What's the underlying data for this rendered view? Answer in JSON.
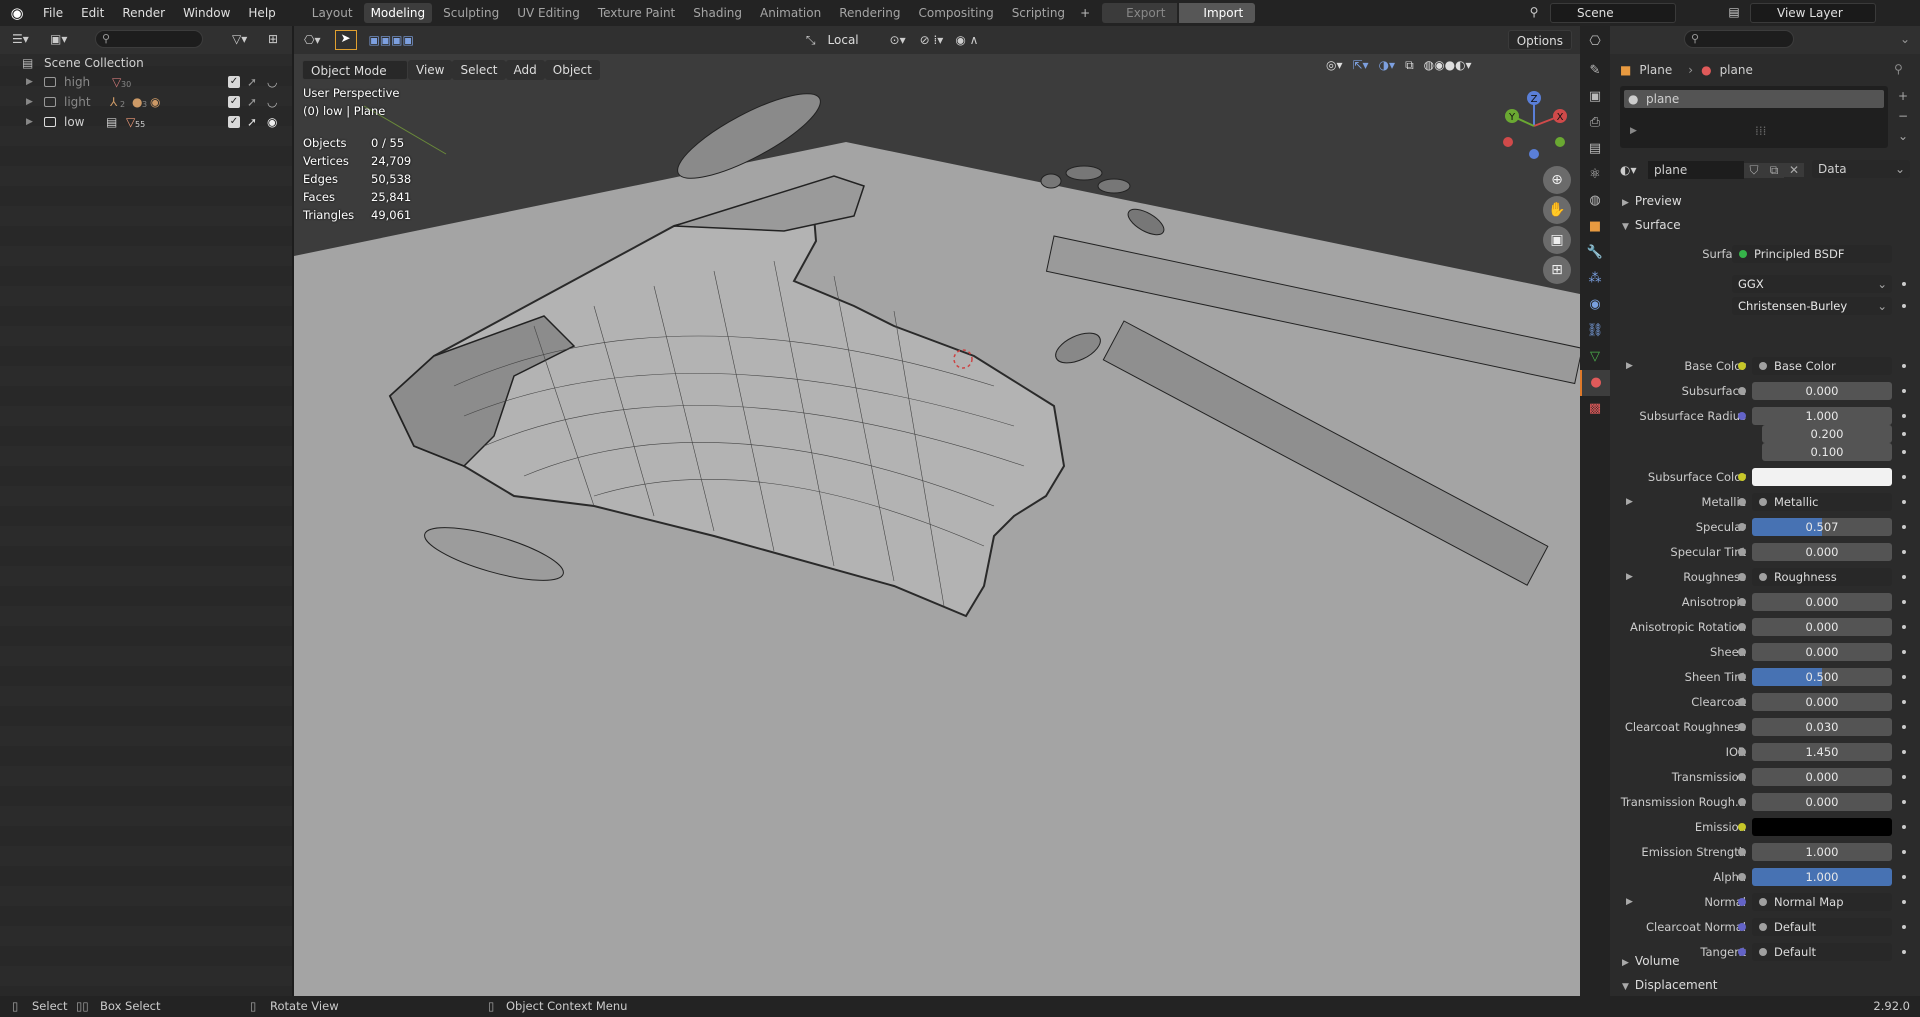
{
  "topbar": {
    "menus": [
      "File",
      "Edit",
      "Render",
      "Window",
      "Help"
    ],
    "workspaces": [
      "Layout",
      "Modeling",
      "Sculpting",
      "UV Editing",
      "Texture Paint",
      "Shading",
      "Animation",
      "Rendering",
      "Compositing",
      "Scripting"
    ],
    "active_workspace": "Modeling",
    "export_label": "Export",
    "import_label": "Import",
    "scene": "Scene",
    "view_layer": "View Layer"
  },
  "outliner": {
    "root": "Scene Collection",
    "collections": [
      {
        "name": "high",
        "count": "30"
      },
      {
        "name": "light",
        "count": "2",
        "count2": "3"
      },
      {
        "name": "low",
        "count": "55"
      }
    ]
  },
  "viewport": {
    "mode": "Object Mode",
    "menus": [
      "View",
      "Select",
      "Add",
      "Object"
    ],
    "orientation": "Local",
    "options": "Options",
    "perspective": "User Perspective",
    "context": "(0) low | Plane",
    "stats": [
      {
        "label": "Objects",
        "value": "0 / 55"
      },
      {
        "label": "Vertices",
        "value": "24,709"
      },
      {
        "label": "Edges",
        "value": "50,538"
      },
      {
        "label": "Faces",
        "value": "25,841"
      },
      {
        "label": "Triangles",
        "value": "49,061"
      }
    ],
    "gizmo": {
      "x": "X",
      "y": "Y",
      "z": "Z"
    }
  },
  "properties": {
    "object": "Plane",
    "data": "plane",
    "material_slot": "plane",
    "material_name": "plane",
    "link_mode": "Data",
    "panels": {
      "preview": "Preview",
      "surface": "Surface",
      "volume": "Volume",
      "displacement": "Displacement"
    },
    "surface_label": "Surface",
    "surface_shader": "Principled BSDF",
    "distribution": "GGX",
    "subsurface_method": "Christensen-Burley",
    "rows": [
      {
        "label": "Base Color",
        "value": "Base Color",
        "kind": "link",
        "dot": "yellow",
        "expand": true
      },
      {
        "label": "Subsurface",
        "value": "0.000",
        "kind": "num"
      },
      {
        "label": "Subsurface Radius",
        "value": "1.000",
        "kind": "num",
        "dot": "blue"
      },
      {
        "label": "",
        "value": "0.200",
        "kind": "num",
        "nodot": true
      },
      {
        "label": "",
        "value": "0.100",
        "kind": "num",
        "nodot": true
      },
      {
        "label": "Subsurface Color",
        "value": "",
        "kind": "color",
        "color": "#f2f2f2",
        "dot": "yellow"
      },
      {
        "label": "Metallic",
        "value": "Metallic",
        "kind": "link",
        "expand": true
      },
      {
        "label": "Specular",
        "value": "0.507",
        "kind": "half"
      },
      {
        "label": "Specular Tint",
        "value": "0.000",
        "kind": "num"
      },
      {
        "label": "Roughness",
        "value": "Roughness",
        "kind": "link",
        "expand": true
      },
      {
        "label": "Anisotropic",
        "value": "0.000",
        "kind": "num"
      },
      {
        "label": "Anisotropic Rotation",
        "value": "0.000",
        "kind": "num"
      },
      {
        "label": "Sheen",
        "value": "0.000",
        "kind": "num"
      },
      {
        "label": "Sheen Tint",
        "value": "0.500",
        "kind": "half"
      },
      {
        "label": "Clearcoat",
        "value": "0.000",
        "kind": "num"
      },
      {
        "label": "Clearcoat Roughness",
        "value": "0.030",
        "kind": "num"
      },
      {
        "label": "IOR",
        "value": "1.450",
        "kind": "num"
      },
      {
        "label": "Transmission",
        "value": "0.000",
        "kind": "num"
      },
      {
        "label": "Transmission Rough...",
        "value": "0.000",
        "kind": "num"
      },
      {
        "label": "Emission",
        "value": "",
        "kind": "color",
        "color": "#000000",
        "dot": "yellow"
      },
      {
        "label": "Emission Strength",
        "value": "1.000",
        "kind": "num"
      },
      {
        "label": "Alpha",
        "value": "1.000",
        "kind": "full"
      },
      {
        "label": "Normal",
        "value": "Normal Map",
        "kind": "link",
        "dot": "blue",
        "expand": true
      },
      {
        "label": "Clearcoat Normal",
        "value": "Default",
        "kind": "link",
        "dot": "blue"
      },
      {
        "label": "Tangent",
        "value": "Default",
        "kind": "link",
        "dot": "blue"
      }
    ]
  },
  "statusbar": {
    "select": "Select",
    "box_select": "Box Select",
    "rotate": "Rotate View",
    "context_menu": "Object Context Menu",
    "version": "2.92.0"
  },
  "colors": {
    "accent": "#4772b3",
    "active_tab": "#e07a2a",
    "viewport_bg": "#999999"
  }
}
